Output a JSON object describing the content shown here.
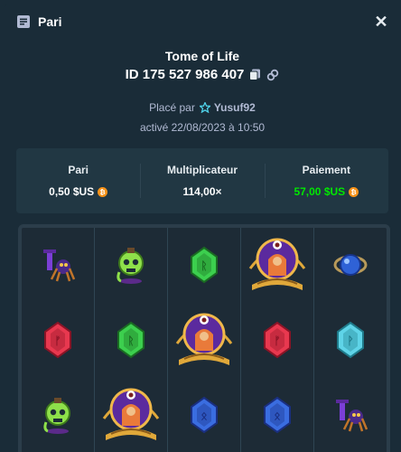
{
  "header": {
    "title": "Pari",
    "icon": "bet-list-icon",
    "close_icon": "close-icon"
  },
  "game": {
    "title": "Tome of Life"
  },
  "bet": {
    "id_text": "ID 175 527 986 407"
  },
  "placed": {
    "prefix": "Placé par",
    "username": "Yusuf92"
  },
  "activated": "activé 22/08/2023 à 10:50",
  "stats": [
    {
      "label": "Pari",
      "value": "0,50 $US",
      "coin": true
    },
    {
      "label": "Multiplicateur",
      "value": "114,00×",
      "coin": false
    },
    {
      "label": "Paiement",
      "value": "57,00 $US",
      "coin": true,
      "color": "#00e701"
    }
  ],
  "colors": {
    "bg": "#1a2c38",
    "panel": "#213743",
    "accent_green": "#00e701",
    "muted": "#b1bad3",
    "coin": "#f7931a"
  },
  "reels": [
    [
      "spider-symbol",
      "red-gem-symbol",
      "skull-potion-symbol"
    ],
    [
      "skull-potion-symbol",
      "green-gem-symbol",
      "sorceress-book-symbol"
    ],
    [
      "green-gem-symbol",
      "sorceress-book-symbol",
      "blue-gem-symbol"
    ],
    [
      "sorceress-book-symbol",
      "red-gem-symbol",
      "blue-gem-symbol"
    ],
    [
      "blue-orb-symbol",
      "cyan-gem-symbol",
      "spider-symbol"
    ]
  ]
}
